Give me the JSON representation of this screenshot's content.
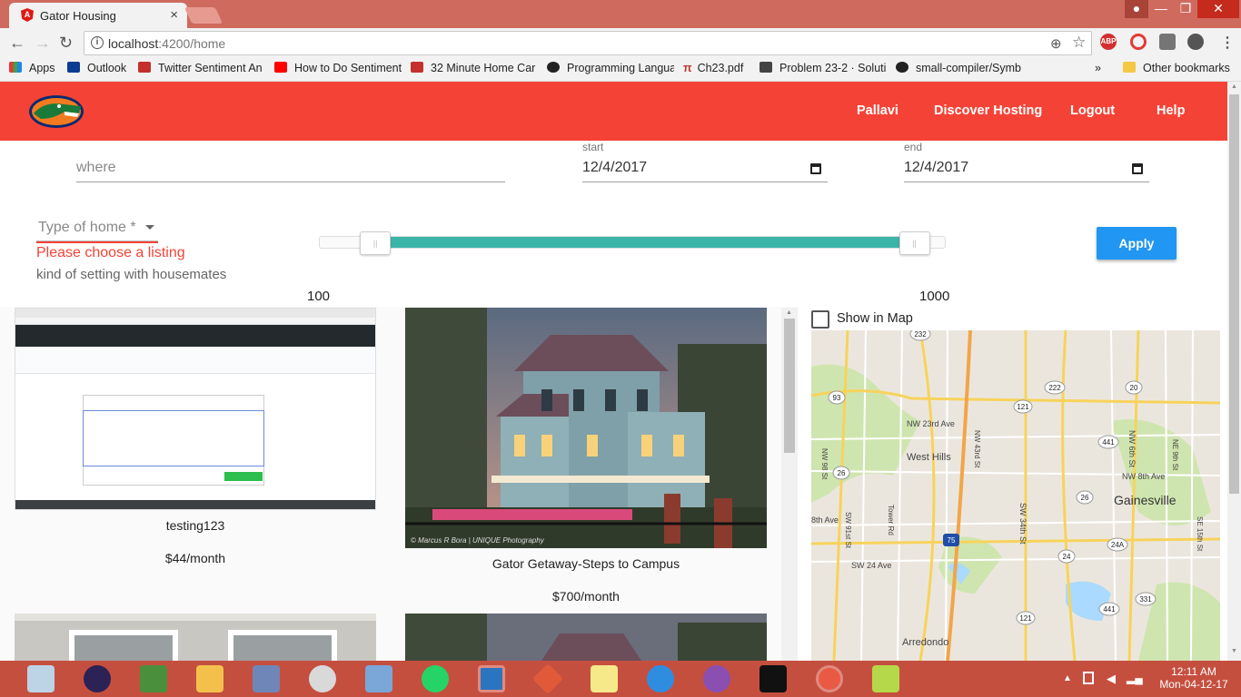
{
  "browser": {
    "tab_title": "Gator Housing",
    "tab_close": "×",
    "url_host": "localhost",
    "url_path": ":4200/home",
    "window_buttons": [
      "—",
      "❐",
      "✕"
    ],
    "extensions": [
      "ABP"
    ],
    "bookmarks": [
      {
        "label": "Apps",
        "color": "#c0392b"
      },
      {
        "label": "Outlook",
        "color": "#0a3d91"
      },
      {
        "label": "Twitter Sentiment An",
        "color": "#c4302b"
      },
      {
        "label": "How to Do Sentiment",
        "color": "#ff0000"
      },
      {
        "label": "32 Minute Home Car",
        "color": "#c4302b"
      },
      {
        "label": "Programming Langua",
        "color": "#222222"
      },
      {
        "label": "Ch23.pdf",
        "color": "#c0392b"
      },
      {
        "label": "Problem 23-2 · Soluti",
        "color": "#444444"
      },
      {
        "label": "small-compiler/Symb",
        "color": "#222222"
      }
    ],
    "bookmarks_more": "»",
    "other_bookmarks": "Other bookmarks"
  },
  "header": {
    "nav": [
      "Pallavi",
      "Discover Hosting",
      "Logout",
      "Help"
    ],
    "brand_color": "#f44336"
  },
  "search": {
    "where_placeholder": "where",
    "start_label": "start",
    "start_value": "12/4/2017",
    "end_label": "end",
    "end_value": "12/4/2017",
    "type_placeholder": "Type of home *",
    "type_error": "Please choose a listing",
    "type_hint": "kind of setting with housemates",
    "price_min": "100",
    "price_max": "1000",
    "price_range_fraction": [
      0.09,
      0.95
    ],
    "apply_label": "Apply"
  },
  "listings": [
    {
      "title": "testing123",
      "price": "$44/month"
    },
    {
      "title": "Gator Getaway-Steps to Campus",
      "price": "$700/month"
    }
  ],
  "listing_photo_credit": "© Marcus R Bora | UNIQUE Photography",
  "map": {
    "show_in_map_label": "Show in Map",
    "labels": [
      "West Hills",
      "Gainesville",
      "NW 23rd Ave",
      "NW 8th Ave",
      "8th Ave",
      "SW 24 Ave",
      "Arredondo",
      "Tower Rd",
      "SW 34th St",
      "NW 43rd St",
      "NW 98 St",
      "SW 91st St",
      "NW 6th St",
      "SE 15th St",
      "NE 9th St"
    ],
    "shields": [
      "232",
      "93",
      "222",
      "20",
      "121",
      "441",
      "26",
      "26",
      "24A",
      "24",
      "331",
      "441",
      "121",
      "75"
    ]
  },
  "taskbar": {
    "time": "12:11 AM",
    "date": "Mon-04-12-17"
  }
}
